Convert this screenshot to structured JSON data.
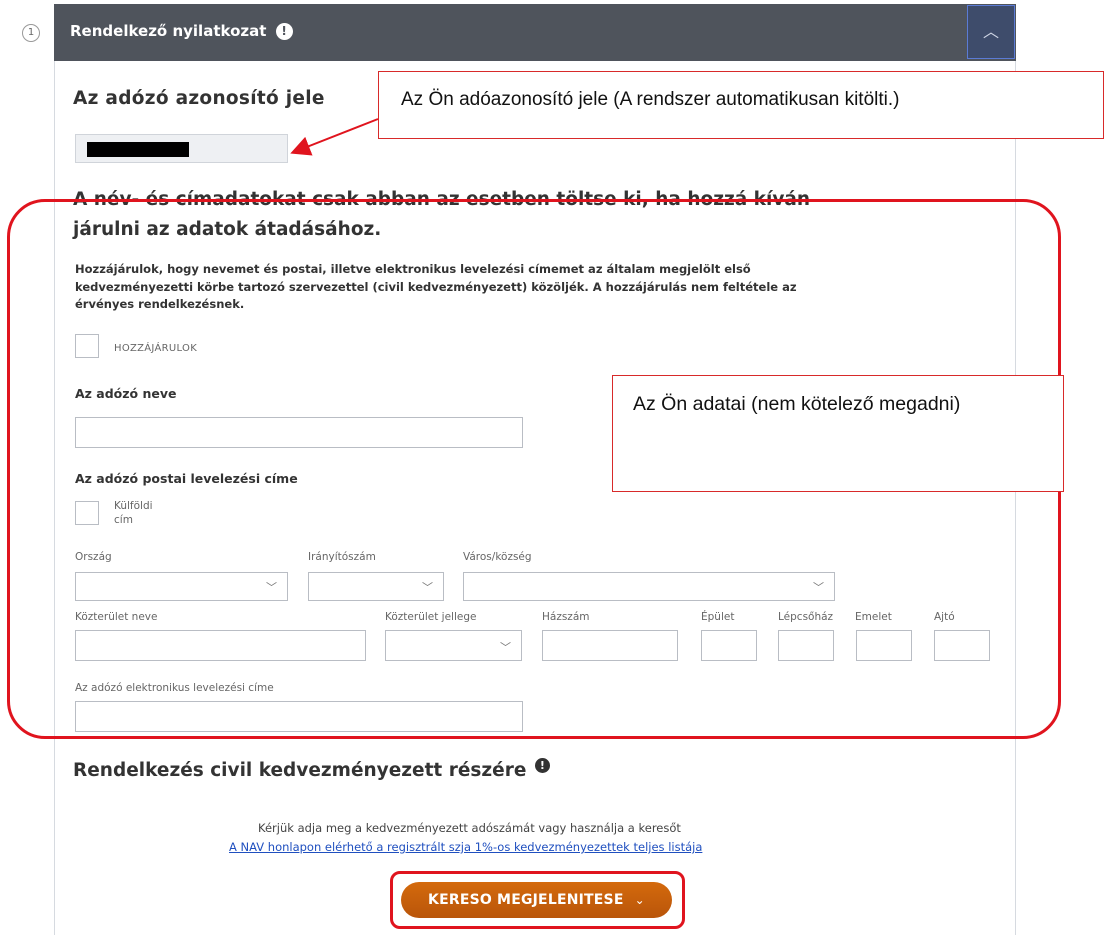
{
  "step": {
    "number": "1"
  },
  "header": {
    "title": "Rendelkező nyilatkozat",
    "info_glyph": "!",
    "collapse_glyph": "︿"
  },
  "taxid": {
    "title": "Az adózó azonosító jele",
    "value": ""
  },
  "callouts": {
    "taxid_note": "Az Ön adóazonosító jele (A rendszer automatikusan kitölti.)",
    "personal_note": "Az Ön adatai (nem kötelező megadni)"
  },
  "consent": {
    "heading_line1": "A név- és címadatokat csak abban az esetben töltse ki, ha hozzá kíván",
    "heading_line2": "járulni az adatok átadásához.",
    "text_line1": "Hozzájárulok, hogy nevemet és postai, illetve elektronikus levelezési címemet az általam megjelölt első",
    "text_line2": "kedvezményezetti körbe tartozó szervezettel (civil kedvezményezett) közöljék. A hozzájárulás nem feltétele az",
    "text_line3": "érvényes rendelkezésnek.",
    "checkbox_label": "HOZZÁJÁRULOK"
  },
  "form": {
    "name_label": "Az adózó neve",
    "postal_label": "Az adózó postai levelezési címe",
    "foreign_line1": "Külföldi",
    "foreign_line2": "cím",
    "country_label": "Ország",
    "zip_label": "Irányítószám",
    "city_label": "Város/község",
    "street_label": "Közterület neve",
    "street_type_label": "Közterület jellege",
    "house_label": "Házszám",
    "building_label": "Épület",
    "stair_label": "Lépcsőház",
    "floor_label": "Emelet",
    "door_label": "Ajtó",
    "email_label": "Az adózó elektronikus levelezési címe"
  },
  "civil": {
    "title": "Rendelkezés civil kedvezményezett részére",
    "info_glyph": "!",
    "instruction": "Kérjük adja meg a kedvezményezett adószámát vagy használja a keresőt",
    "link": "A NAV honlapon elérhető a regisztrált szja 1%-os kedvezményezettek teljes listája",
    "button_label": "KERESO MEGJELENITESE",
    "button_chevron": "⌄"
  },
  "colors": {
    "header_bg": "#4f545c",
    "annotation_red": "#e0141e",
    "button_orange": "#c65f0c"
  }
}
